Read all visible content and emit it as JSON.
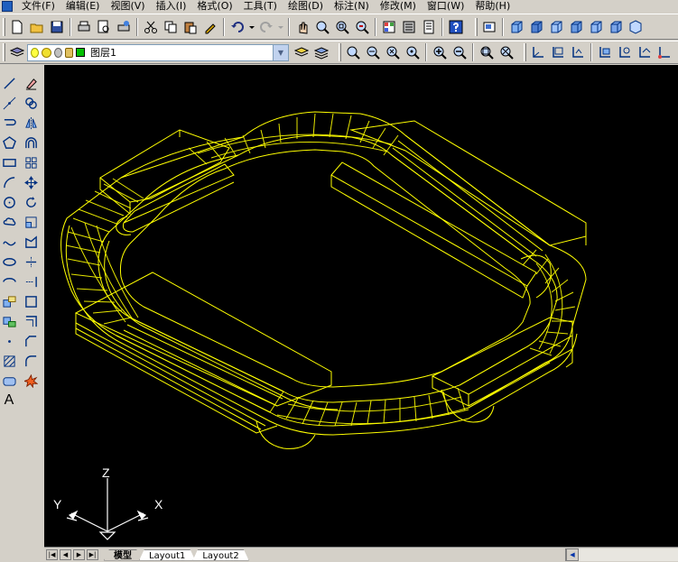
{
  "menu": {
    "items": [
      "文件(F)",
      "编辑(E)",
      "视图(V)",
      "插入(I)",
      "格式(O)",
      "工具(T)",
      "绘图(D)",
      "标注(N)",
      "修改(M)",
      "窗口(W)",
      "帮助(H)"
    ]
  },
  "layer": {
    "current_name": "图层1",
    "color_swatch": "#00c000"
  },
  "ucs": {
    "x_label": "X",
    "y_label": "Y",
    "z_label": "Z"
  },
  "tabs": {
    "model": "模型",
    "layout1": "Layout1",
    "layout2": "Layout2"
  },
  "left_toolbar": {
    "text_tool_label": "A"
  },
  "colors": {
    "drawing_bg": "#000000",
    "wireframe": "#ffff00",
    "ucs_icon": "#ffffff",
    "ui_face": "#d4d0c8"
  }
}
